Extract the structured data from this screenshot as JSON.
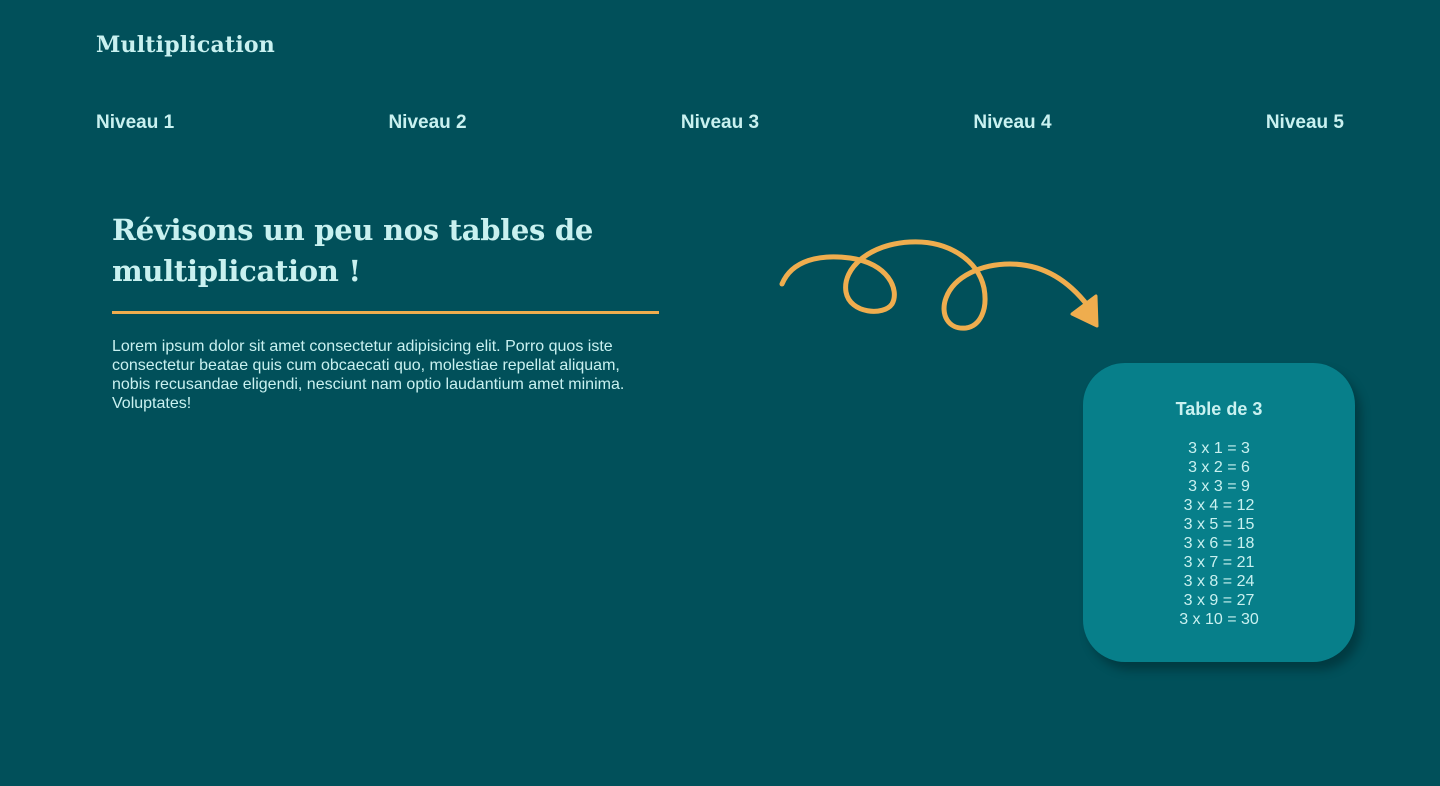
{
  "site": {
    "logo": "Multiplication"
  },
  "nav": {
    "items": [
      {
        "label": "Niveau 1"
      },
      {
        "label": "Niveau 2"
      },
      {
        "label": "Niveau 3"
      },
      {
        "label": "Niveau 4"
      },
      {
        "label": "Niveau 5"
      }
    ]
  },
  "hero": {
    "title_line1": "Révisons un peu nos tables de",
    "title_line2": "multiplication !",
    "body": "Lorem ipsum dolor sit amet consectetur adipisicing elit. Porro quos iste consectetur beatae quis cum obcaecati quo, molestiae repellat aliquam, nobis recusandae eligendi, nesciunt nam optio laudantium amet minima. Voluptates!"
  },
  "decor": {
    "arrow_icon": "curly-arrow-icon"
  },
  "card": {
    "title": "Table de 3",
    "rows": [
      "3 x 1 = 3",
      "3 x 2 = 6",
      "3 x 3 = 9",
      "3 x 4 = 12",
      "3 x 5 = 15",
      "3 x 6 = 18",
      "3 x 7 = 21",
      "3 x 8 = 24",
      "3 x 9 = 27",
      "3 x 10 = 30"
    ]
  },
  "colors": {
    "background": "#01505a",
    "text": "#c9f1f0",
    "accent": "#efad4e",
    "card": "#077f8a"
  }
}
